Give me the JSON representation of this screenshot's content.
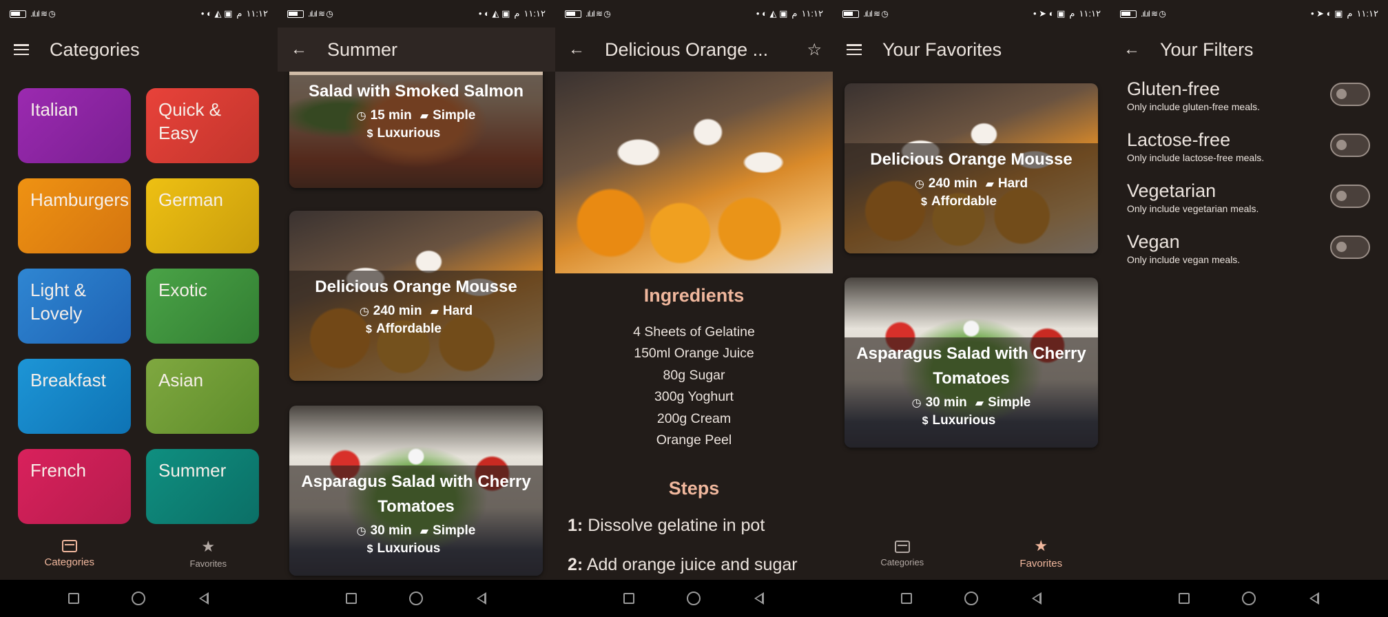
{
  "status": {
    "time": "١١:١٢",
    "ampm": "م",
    "net": "Vo LTE"
  },
  "screens": {
    "categories": {
      "title": "Categories",
      "items": [
        {
          "label": "Italian",
          "c1": "#9b2ab0",
          "c2": "#7a1f92"
        },
        {
          "label": "Quick & Easy",
          "c1": "#e8423a",
          "c2": "#c2352c"
        },
        {
          "label": "Hamburgers",
          "c1": "#ef9212",
          "c2": "#d47510"
        },
        {
          "label": "German",
          "c1": "#eec013",
          "c2": "#c99d0c"
        },
        {
          "label": "Light & Lovely",
          "c1": "#2f86d2",
          "c2": "#1e63b4"
        },
        {
          "label": "Exotic",
          "c1": "#4aa347",
          "c2": "#327e32"
        },
        {
          "label": "Breakfast",
          "c1": "#1d95d6",
          "c2": "#0e73b4"
        },
        {
          "label": "Asian",
          "c1": "#7fa840",
          "c2": "#5e8c2a"
        },
        {
          "label": "French",
          "c1": "#d9215c",
          "c2": "#b61c4d"
        },
        {
          "label": "Summer",
          "c1": "#0f8f80",
          "c2": "#0b6f66"
        }
      ]
    },
    "summer": {
      "title": "Summer",
      "meals": [
        {
          "title": "Salad with Smoked Salmon",
          "duration": "15 min",
          "complexity": "Simple",
          "affordability": "Luxurious"
        },
        {
          "title": "Delicious Orange Mousse",
          "duration": "240 min",
          "complexity": "Hard",
          "affordability": "Affordable"
        },
        {
          "title": "Asparagus Salad with Cherry Tomatoes",
          "duration": "30 min",
          "complexity": "Simple",
          "affordability": "Luxurious"
        }
      ]
    },
    "detail": {
      "title": "Delicious Orange ...",
      "ingredients_title": "Ingredients",
      "ingredients": [
        "4 Sheets of Gelatine",
        "150ml Orange Juice",
        "80g Sugar",
        "300g Yoghurt",
        "200g Cream",
        "Orange Peel"
      ],
      "steps_title": "Steps",
      "steps": [
        {
          "num": "1:",
          "text": "Dissolve gelatine in pot"
        },
        {
          "num": "2:",
          "text": "Add orange juice and sugar"
        }
      ]
    },
    "favorites": {
      "title": "Your Favorites",
      "meals": [
        {
          "title": "Delicious Orange Mousse",
          "duration": "240 min",
          "complexity": "Hard",
          "affordability": "Affordable"
        },
        {
          "title": "Asparagus Salad with Cherry Tomatoes",
          "duration": "30 min",
          "complexity": "Simple",
          "affordability": "Luxurious"
        }
      ]
    },
    "filters": {
      "title": "Your Filters",
      "items": [
        {
          "title": "Gluten-free",
          "subtitle": "Only include gluten-free meals."
        },
        {
          "title": "Lactose-free",
          "subtitle": "Only include lactose-free meals."
        },
        {
          "title": "Vegetarian",
          "subtitle": "Only include vegetarian meals."
        },
        {
          "title": "Vegan",
          "subtitle": "Only include vegan meals."
        }
      ]
    }
  },
  "tabs": {
    "categories": "Categories",
    "favorites": "Favorites"
  },
  "colors": {
    "accent": "#f0b79d",
    "background": "#221c19"
  }
}
